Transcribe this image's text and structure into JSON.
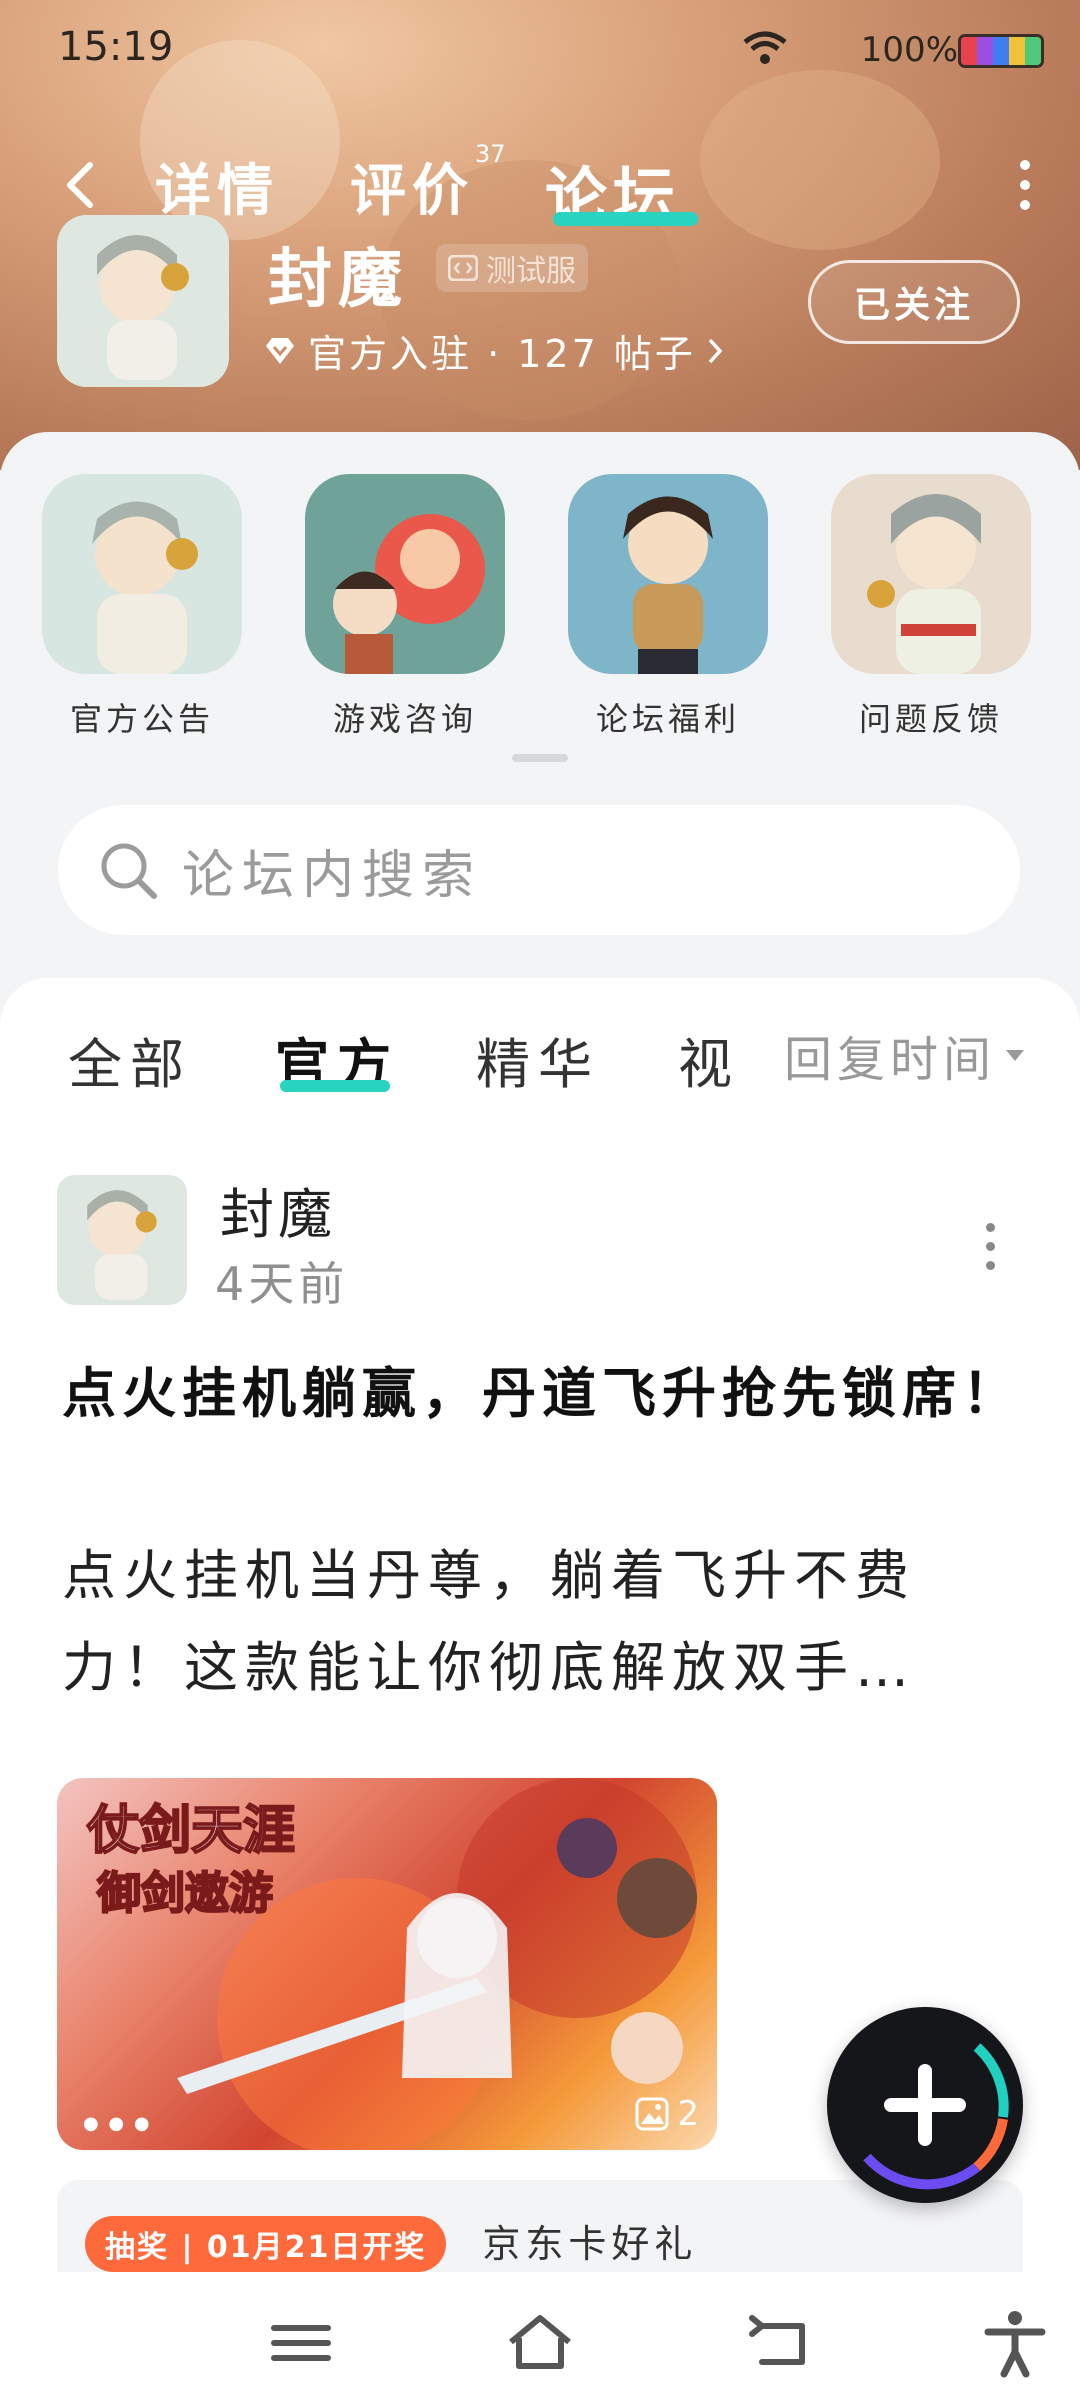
{
  "status_bar": {
    "time": "15:19",
    "battery": "100%"
  },
  "nav": {
    "tabs": [
      {
        "label": "详情"
      },
      {
        "label": "评价",
        "count": "37"
      },
      {
        "label": "论坛"
      }
    ]
  },
  "game": {
    "name": "封魔",
    "badge": "测试服",
    "meta": "官方入驻 · 127 帖子",
    "follow_label": "已关注"
  },
  "categories": [
    {
      "label": "官方公告"
    },
    {
      "label": "游戏咨询"
    },
    {
      "label": "论坛福利"
    },
    {
      "label": "问题反馈"
    }
  ],
  "search": {
    "placeholder": "论坛内搜索"
  },
  "feed": {
    "tabs": [
      "全部",
      "官方",
      "精华",
      "视"
    ],
    "sort_label": "回复时间",
    "post": {
      "author": "封魔",
      "time": "4天前",
      "title": "点火挂机躺赢，丹道飞升抢先锁席！",
      "body": "点火挂机当丹尊，躺着飞升不费力！这款能让你彻底解放双手…",
      "image_count": "2",
      "image_logo": "仗剑天涯\n御剑遨游",
      "lottery_tag": "抽奖 | 01月21日开奖",
      "lottery_text": "京东卡好礼"
    }
  },
  "colors": {
    "accent": "#28d4c0",
    "lottery": "#ff6a3d"
  }
}
